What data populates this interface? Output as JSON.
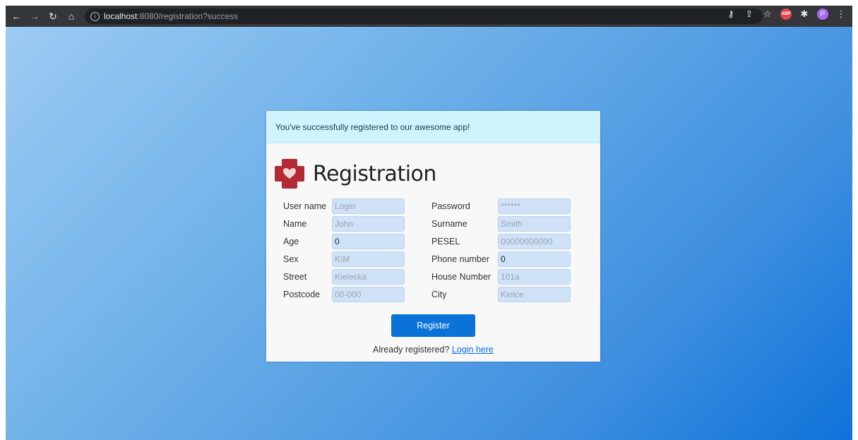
{
  "browser": {
    "url_host": "localhost",
    "url_path": ":8080/registration?success"
  },
  "alert": {
    "message": "You've successfully registered to our awesome app!"
  },
  "form": {
    "title": "Registration",
    "rows": [
      {
        "left_label": "User name",
        "left_value": "Login",
        "right_label": "Password",
        "right_value": "******"
      },
      {
        "left_label": "Name",
        "left_value": "John",
        "right_label": "Surname",
        "right_value": "Smith"
      },
      {
        "left_label": "Age",
        "left_value": "0",
        "right_label": "PESEL",
        "right_value": "00000000000"
      },
      {
        "left_label": "Sex",
        "left_value": "K\\M",
        "right_label": "Phone number",
        "right_value": "0"
      },
      {
        "left_label": "Street",
        "left_value": "Kielecka",
        "right_label": "House Number",
        "right_value": "101a"
      },
      {
        "left_label": "Postcode",
        "left_value": "00-000",
        "right_label": "City",
        "right_value": "Kielce"
      }
    ],
    "register_label": "Register",
    "already_text": "Already registered?",
    "login_link": "Login here"
  },
  "colors": {
    "accent": "#0b73d8",
    "alert_bg": "#cff4fc",
    "field_bg": "#cfe2f7",
    "logo": "#b22a33"
  }
}
